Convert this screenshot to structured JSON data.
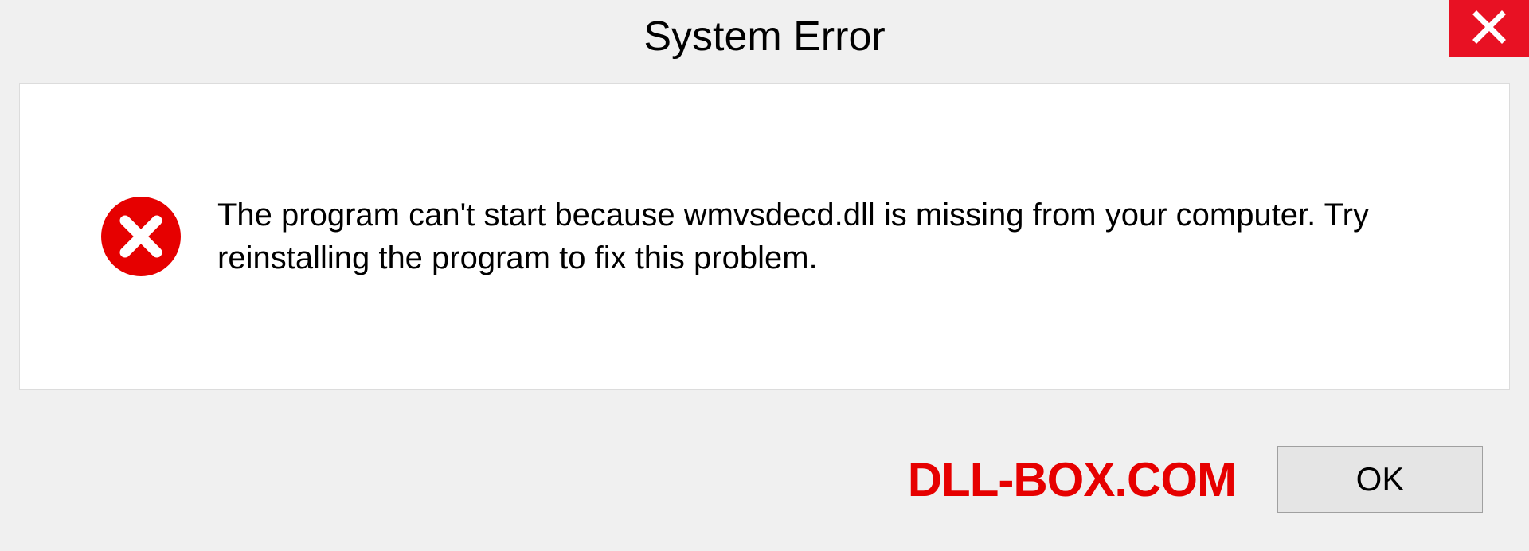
{
  "header": {
    "title": "System Error"
  },
  "content": {
    "message": "The program can't start because wmvsdecd.dll is missing from your computer. Try reinstalling the program to fix this problem."
  },
  "footer": {
    "watermark": "DLL-BOX.COM",
    "ok_label": "OK"
  },
  "colors": {
    "close_bg": "#e81123",
    "error_icon": "#e60000",
    "watermark": "#e60000"
  }
}
